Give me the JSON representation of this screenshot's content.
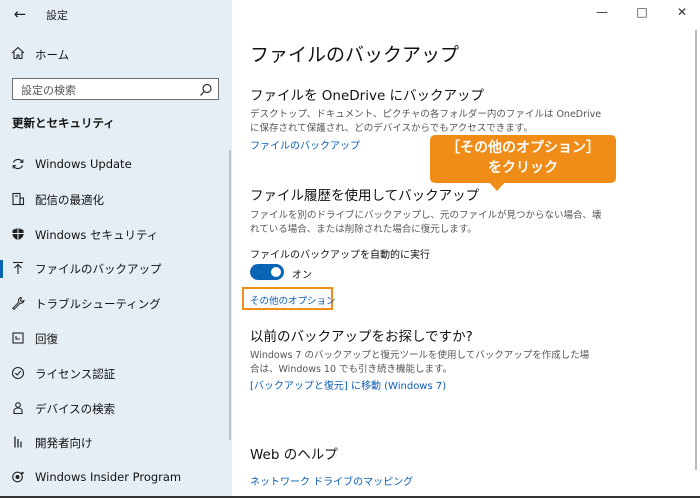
{
  "app": {
    "title": "設定"
  },
  "sidebar": {
    "home_label": "ホーム",
    "search_placeholder": "設定の検索",
    "section_heading": "更新とセキュリティ",
    "items": [
      {
        "label": "Windows Update",
        "icon": "sync-icon"
      },
      {
        "label": "配信の最適化",
        "icon": "delivery-icon"
      },
      {
        "label": "Windows セキュリティ",
        "icon": "shield-icon"
      },
      {
        "label": "ファイルのバックアップ",
        "icon": "backup-arrow-icon",
        "selected": true
      },
      {
        "label": "トラブルシューティング",
        "icon": "wrench-icon"
      },
      {
        "label": "回復",
        "icon": "recovery-icon"
      },
      {
        "label": "ライセンス認証",
        "icon": "check-circle-icon"
      },
      {
        "label": "デバイスの検索",
        "icon": "person-location-icon"
      },
      {
        "label": "開発者向け",
        "icon": "developer-icon"
      },
      {
        "label": "Windows Insider Program",
        "icon": "insider-icon"
      }
    ]
  },
  "main": {
    "title": "ファイルのバックアップ",
    "onedrive": {
      "heading": "ファイルを OneDrive にバックアップ",
      "description": "デスクトップ、ドキュメント、ピクチャの各フォルダー内のファイルは OneDrive に保存されて保護され、どのデバイスからでもアクセスできます。",
      "link": "ファイルのバックアップ"
    },
    "history": {
      "heading": "ファイル履歴を使用してバックアップ",
      "description": "ファイルを別のドライブにバックアップし、元のファイルが見つからない場合、壊れている場合、または削除された場合に復元します。",
      "auto_label": "ファイルのバックアップを自動的に実行",
      "toggle_state": "オン",
      "more_options": "その他のオプション"
    },
    "older": {
      "heading": "以前のバックアップをお探しですか?",
      "description": "Windows 7 のバックアップと復元ツールを使用してバックアップを作成した場合は、Windows 10 でも引き続き機能します。",
      "link": "[バックアップと復元] に移動 (Windows 7)"
    },
    "help": {
      "heading": "Web のヘルプ",
      "link": "ネットワーク ドライブのマッピング"
    }
  },
  "callout": {
    "line1": "［その他のオプション］",
    "line2": "をクリック",
    "color": "#f08c18"
  },
  "colors": {
    "accent": "#0a64b4",
    "link": "#0a5db8",
    "sidebar_bg": "#e6eef5"
  }
}
